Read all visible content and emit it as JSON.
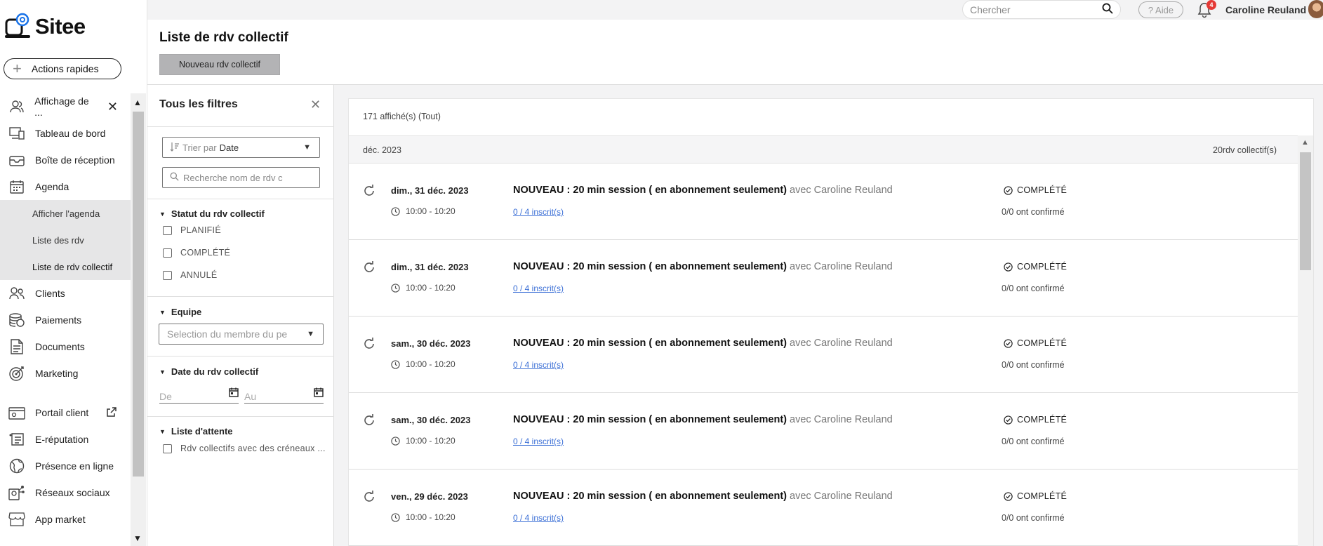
{
  "app": {
    "logo": "Sitee"
  },
  "sidebar": {
    "quick_actions": "Actions rapides",
    "items": [
      {
        "label": "Affichage de ...",
        "icon": "users-icon"
      },
      {
        "label": "Tableau de bord",
        "icon": "dashboard-icon"
      },
      {
        "label": "Boîte de réception",
        "icon": "inbox-icon"
      },
      {
        "label": "Agenda",
        "icon": "calendar-icon"
      }
    ],
    "sub_items": [
      "Afficher l'agenda",
      "Liste des rdv",
      "Liste de rdv collectif"
    ],
    "items2": [
      {
        "label": "Clients",
        "icon": "clients-icon"
      },
      {
        "label": "Paiements",
        "icon": "payments-icon"
      },
      {
        "label": "Documents",
        "icon": "documents-icon"
      },
      {
        "label": "Marketing",
        "icon": "marketing-icon"
      }
    ],
    "items3": [
      {
        "label": "Portail client",
        "icon": "portal-icon"
      },
      {
        "label": "E-réputation",
        "icon": "reputation-icon"
      },
      {
        "label": "Présence en ligne",
        "icon": "globe-icon"
      },
      {
        "label": "Réseaux sociaux",
        "icon": "social-icon"
      },
      {
        "label": "App market",
        "icon": "store-icon"
      }
    ]
  },
  "topbar": {
    "search_placeholder": "Chercher",
    "help": "? Aide",
    "notifications": "4",
    "user": "Caroline Reuland"
  },
  "header": {
    "title": "Liste de rdv collectif",
    "new_button": "Nouveau rdv collectif"
  },
  "filters": {
    "title": "Tous les filtres",
    "sort_label": "Trier par",
    "sort_value": "Date",
    "search_placeholder": "Recherche nom de rdv c",
    "status_title": "Statut du rdv collectif",
    "statuses": [
      "PLANIFIÉ",
      "COMPLÉTÉ",
      "ANNULÉ"
    ],
    "team_title": "Equipe",
    "team_placeholder": "Selection du membre du pe",
    "date_title": "Date du rdv collectif",
    "date_from": "De",
    "date_to": "Au",
    "waitlist_title": "Liste d'attente",
    "waitlist_option": "Rdv collectifs avec des créneaux ..."
  },
  "list": {
    "count": "171 affiché(s) (Tout)",
    "month": "déc. 2023",
    "month_count": "20rdv collectif(s)",
    "rows": [
      {
        "date": "dim., 31 déc. 2023",
        "time": "10:00 - 10:20",
        "title": "NOUVEAU : 20 min session ( en abonnement seulement)",
        "with": " avec Caroline Reuland",
        "enrolled": "0 / 4 inscrit(s)",
        "status": "COMPLÉTÉ",
        "confirmed": "0/0 ont confirmé"
      },
      {
        "date": "dim., 31 déc. 2023",
        "time": "10:00 - 10:20",
        "title": "NOUVEAU : 20 min session ( en abonnement seulement)",
        "with": " avec Caroline Reuland",
        "enrolled": "0 / 4 inscrit(s)",
        "status": "COMPLÉTÉ",
        "confirmed": "0/0 ont confirmé"
      },
      {
        "date": "sam., 30 déc. 2023",
        "time": "10:00 - 10:20",
        "title": "NOUVEAU : 20 min session ( en abonnement seulement)",
        "with": " avec Caroline Reuland",
        "enrolled": "0 / 4 inscrit(s)",
        "status": "COMPLÉTÉ",
        "confirmed": "0/0 ont confirmé"
      },
      {
        "date": "sam., 30 déc. 2023",
        "time": "10:00 - 10:20",
        "title": "NOUVEAU : 20 min session ( en abonnement seulement)",
        "with": " avec Caroline Reuland",
        "enrolled": "0 / 4 inscrit(s)",
        "status": "COMPLÉTÉ",
        "confirmed": "0/0 ont confirmé"
      },
      {
        "date": "ven., 29 déc. 2023",
        "time": "10:00 - 10:20",
        "title": "NOUVEAU : 20 min session ( en abonnement seulement)",
        "with": " avec Caroline Reuland",
        "enrolled": "0 / 4 inscrit(s)",
        "status": "COMPLÉTÉ",
        "confirmed": "0/0 ont confirmé"
      }
    ]
  },
  "colors": {
    "link": "#3b6fd6",
    "badge": "#e53935",
    "logo_accent": "#1a73e8"
  }
}
